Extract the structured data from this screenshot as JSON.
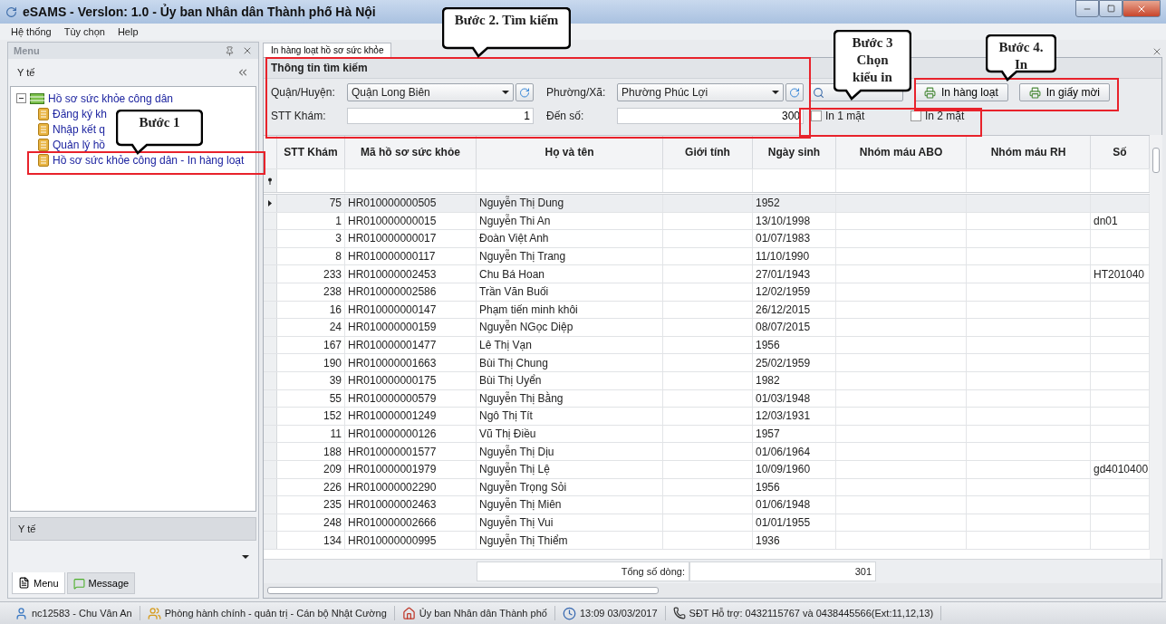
{
  "window": {
    "title": "eSAMS - Verslon: 1.0 - Ủy ban Nhân dân Thành phố Hà Nội"
  },
  "menu_bar": [
    "Hệ thống",
    "Tùy chọn",
    "Help"
  ],
  "sidebar": {
    "title": "Menu",
    "section": "Y tế",
    "tree": [
      {
        "label": "Hồ sơ sức khỏe công dân",
        "expanded": true,
        "children": [
          {
            "label": "Đăng ký kh"
          },
          {
            "label": "Nhập kết q"
          },
          {
            "label": "Quản lý hồ"
          },
          {
            "label": "Hồ sơ sức khỏe công dân - In hàng loạt"
          }
        ]
      }
    ],
    "bottom_section": "Y tế",
    "tabs": [
      {
        "label": "Menu",
        "selected": true
      },
      {
        "label": "Message",
        "selected": false
      }
    ]
  },
  "document_tab": {
    "label": "In hàng loạt hồ sơ sức khỏe",
    "selected": true
  },
  "search_panel": {
    "title": "Thông tin tìm kiếm",
    "district": {
      "label": "Quận/Huyện:",
      "value": "Quận Long Biên"
    },
    "ward": {
      "label": "Phường/Xã:",
      "value": "Phường Phúc Lợi"
    },
    "from": {
      "label": "STT Khám:",
      "value": "1"
    },
    "to": {
      "label": "Đến số:",
      "value": "300"
    },
    "print_options": [
      {
        "label": "In 1 mặt",
        "checked": false
      },
      {
        "label": "In 2 mặt",
        "checked": false
      }
    ],
    "buttons": [
      "In hàng loạt",
      "In giấy mời"
    ]
  },
  "table": {
    "columns": [
      "STT Khám",
      "Mã hồ sơ sức khỏe",
      "Họ và tên",
      "Giới tính",
      "Ngày sinh",
      "Nhóm máu ABO",
      "Nhóm máu RH",
      "Số"
    ],
    "rows": [
      {
        "stt": "75",
        "code": "HR010000000505",
        "name": "Nguyễn Thị Dung",
        "dob": "1952",
        "selected": true
      },
      {
        "stt": "1",
        "code": "HR010000000015",
        "name": "Nguyễn Thi An",
        "dob": "13/10/1998",
        "column_8": "dn01",
        "selected": false
      },
      {
        "stt": "3",
        "code": "HR010000000017",
        "name": "Đoàn Việt Anh",
        "dob": "01/07/1983",
        "selected": false
      },
      {
        "stt": "8",
        "code": "HR010000000117",
        "name": "Nguyễn Thị Trang",
        "dob": "11/10/1990",
        "selected": false
      },
      {
        "stt": "233",
        "code": "HR010000002453",
        "name": "Chu Bá Hoan",
        "dob": "27/01/1943",
        "column_8": "HT201040",
        "selected": false
      },
      {
        "stt": "238",
        "code": "HR010000002586",
        "name": "Trần Văn Buối",
        "dob": "12/02/1959",
        "selected": false
      },
      {
        "stt": "16",
        "code": "HR010000000147",
        "name": "Phạm tiến minh khôi",
        "dob": "26/12/2015",
        "selected": false
      },
      {
        "stt": "24",
        "code": "HR010000000159",
        "name": "Nguyễn NGọc Diệp",
        "dob": "08/07/2015",
        "selected": false
      },
      {
        "stt": "167",
        "code": "HR010000001477",
        "name": "Lê Thị Vạn",
        "dob": "1956",
        "selected": false
      },
      {
        "stt": "190",
        "code": "HR010000001663",
        "name": "Bùi Thị Chung",
        "dob": "25/02/1959",
        "selected": false
      },
      {
        "stt": "39",
        "code": "HR010000000175",
        "name": "Bùi Thị Uyển",
        "dob": "1982",
        "selected": false
      },
      {
        "stt": "55",
        "code": "HR010000000579",
        "name": "Nguyễn Thị Bằng",
        "dob": "01/03/1948",
        "selected": false
      },
      {
        "stt": "152",
        "code": "HR010000001249",
        "name": "Ngô Thị Tít",
        "dob": "12/03/1931",
        "selected": false
      },
      {
        "stt": "11",
        "code": "HR010000000126",
        "name": "Vũ Thị Điều",
        "dob": "1957",
        "selected": false
      },
      {
        "stt": "188",
        "code": "HR010000001577",
        "name": "Nguyễn Thị Dịu",
        "dob": "01/06/1964",
        "selected": false
      },
      {
        "stt": "209",
        "code": "HR010000001979",
        "name": "Nguyễn Thị Lệ",
        "dob": "10/09/1960",
        "column_8": "gd4010400",
        "selected": false
      },
      {
        "stt": "226",
        "code": "HR010000002290",
        "name": "Nguyễn Trọng Sỏi",
        "dob": "1956",
        "selected": false
      },
      {
        "stt": "235",
        "code": "HR010000002463",
        "name": "Nguyễn Thị Miên",
        "dob": "01/06/1948",
        "selected": false
      },
      {
        "stt": "248",
        "code": "HR010000002666",
        "name": "Nguyễn Thị Vui",
        "dob": "01/01/1955",
        "selected": false
      },
      {
        "stt": "134",
        "code": "HR010000000995",
        "name": "Nguyễn Thị Thiểm",
        "dob": "1936",
        "selected": false
      }
    ],
    "footer": {
      "label": "Tổng số dòng:",
      "value": "301"
    }
  },
  "status_bar": [
    {
      "kind": "user",
      "text": "nc12583 - Chu Vân An"
    },
    {
      "kind": "group",
      "text": "Phòng hành chính - quản trị - Cán bộ Nhật Cường"
    },
    {
      "kind": "building",
      "text": "Ủy ban Nhân dân Thành phố"
    },
    {
      "kind": "clock",
      "text": "13:09 03/03/2017"
    },
    {
      "kind": "phone",
      "text": "SĐT Hỗ trợ: 0432115767 và 0438445566(Ext:11,12,13)"
    }
  ],
  "callouts": [
    {
      "lines": [
        "Bước 2. Tìm kiếm"
      ]
    },
    {
      "lines": [
        "Bước 1"
      ]
    },
    {
      "lines": [
        "Bước 3",
        "Chọn",
        "kiểu in"
      ]
    },
    {
      "lines": [
        "Bước 4.",
        "In"
      ]
    }
  ]
}
